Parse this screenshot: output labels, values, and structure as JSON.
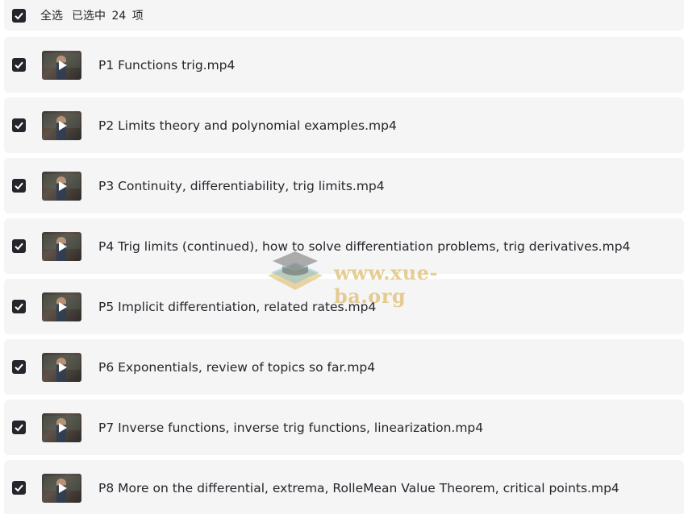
{
  "header": {
    "select_all_label": "全选",
    "selected_info": "已选中 24 项"
  },
  "files": [
    {
      "title": "P1 Functions trig.mp4"
    },
    {
      "title": "P2 Limits theory and polynomial examples.mp4"
    },
    {
      "title": "P3 Continuity, differentiability, trig limits.mp4"
    },
    {
      "title": "P4 Trig limits (continued), how to solve differentiation problems, trig derivatives.mp4"
    },
    {
      "title": "P5 Implicit differentiation, related rates.mp4"
    },
    {
      "title": "P6 Exponentials, review of topics so far.mp4"
    },
    {
      "title": "P7 Inverse functions, inverse trig functions, linearization.mp4"
    },
    {
      "title": "P8 More on the differential, extrema, RolleMean Value Theorem, critical points.mp4"
    }
  ],
  "watermark": {
    "text": "www.xue-ba.org"
  },
  "colors": {
    "checkbox": "#25262b",
    "row_bg": "#f5f5f6",
    "watermark": "#d6a83c"
  }
}
